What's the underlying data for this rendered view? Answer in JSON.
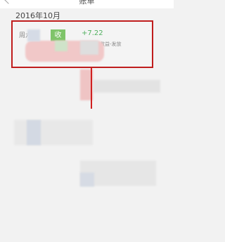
{
  "header": {
    "title": "账单"
  },
  "month_label": "2016年10月",
  "entry": {
    "weekday": "周六",
    "type_badge": "收",
    "amount": "+7.22",
    "description": "收益-发放"
  },
  "colors": {
    "highlight_box": "#c01d1d",
    "income_green": "#52b060",
    "badge_green": "#7fc46a"
  }
}
